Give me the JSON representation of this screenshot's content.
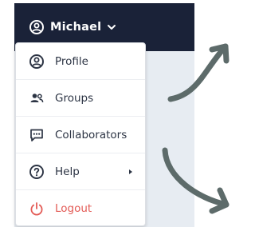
{
  "header": {
    "user_name": "Michael",
    "user_icon": "user-circle-icon",
    "dropdown_icon": "chevron-down-icon"
  },
  "menu": {
    "items": [
      {
        "label": "Profile",
        "icon": "user-circle-icon"
      },
      {
        "label": "Groups",
        "icon": "people-icon"
      },
      {
        "label": "Collaborators",
        "icon": "chat-dots-icon"
      },
      {
        "label": "Help",
        "icon": "help-circle-icon",
        "submenu_icon": "caret-right-icon"
      },
      {
        "label": "Logout",
        "icon": "power-icon"
      }
    ]
  },
  "colors": {
    "topbar": "#1a2238",
    "panel": "#e7ecf2",
    "text": "#2c3444",
    "logout": "#e35b56",
    "arrow": "#5d6b6a"
  }
}
